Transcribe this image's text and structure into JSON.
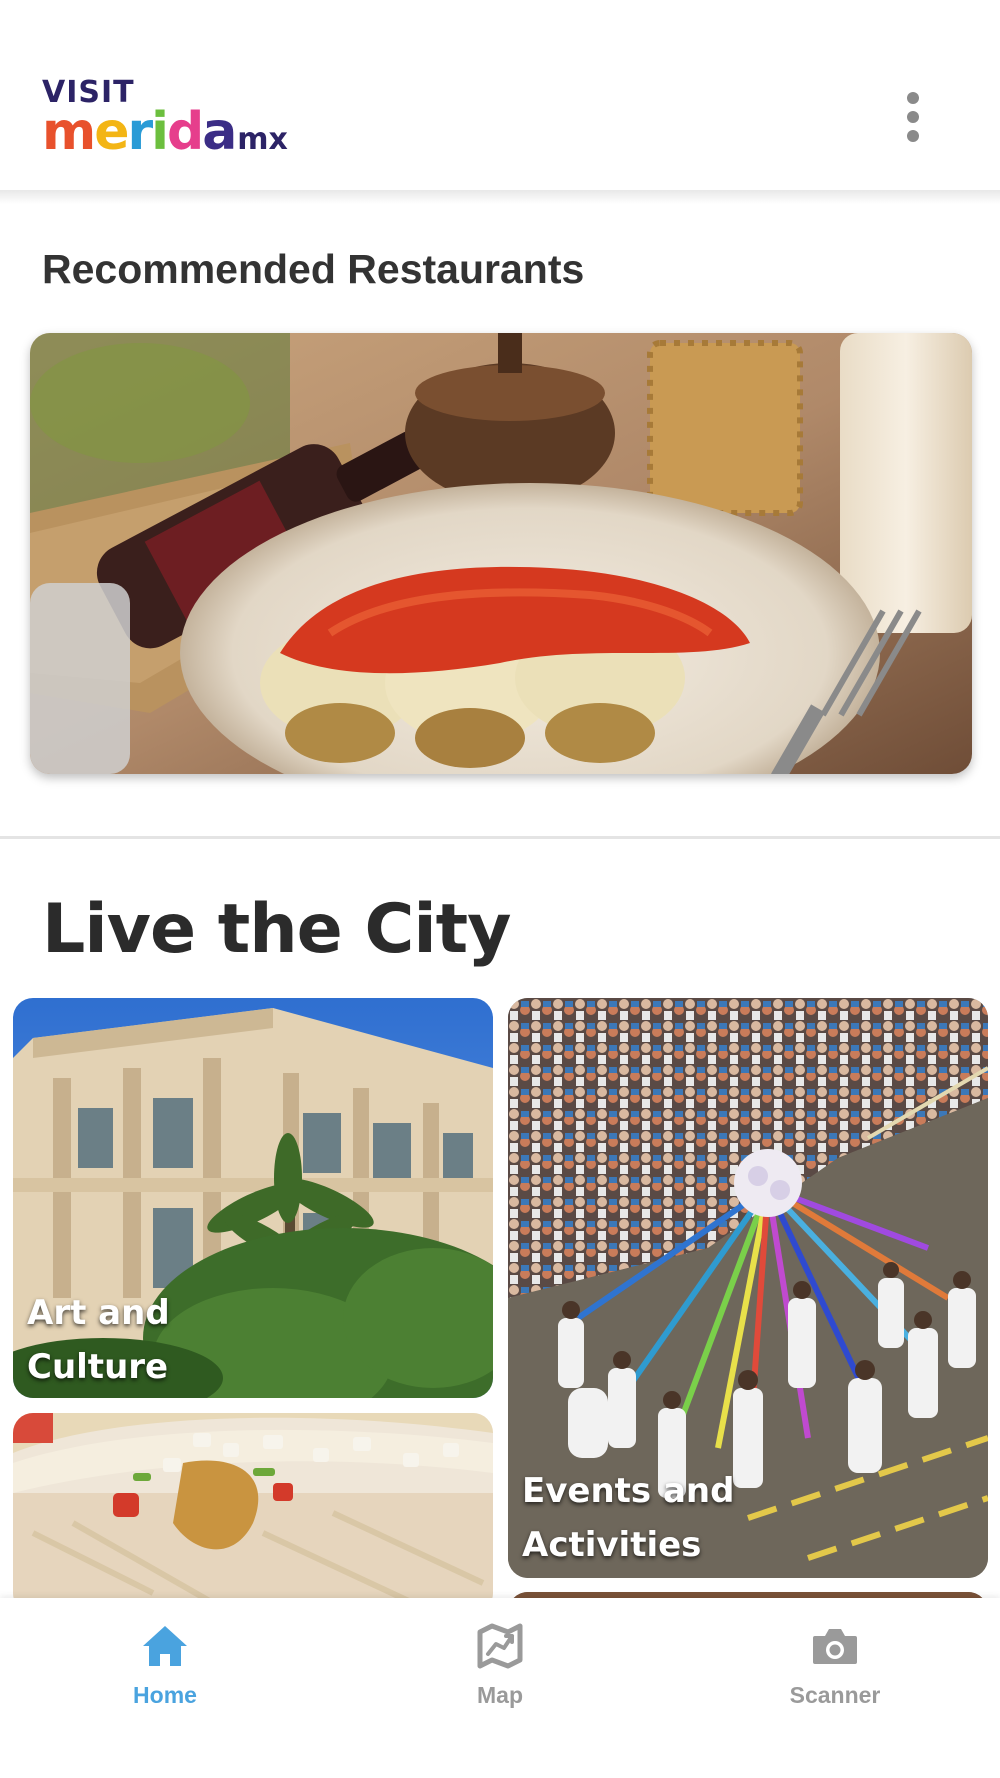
{
  "header": {
    "logo_visit": "VISIT",
    "logo_letters": [
      {
        "char": "m",
        "color": "#e8512c"
      },
      {
        "char": "e",
        "color": "#f3b515"
      },
      {
        "char": "r",
        "color": "#2a9bd6"
      },
      {
        "char": "i",
        "color": "#6cbf3e"
      },
      {
        "char": "d",
        "color": "#e63e8c"
      },
      {
        "char": "a",
        "color": "#3b2d86"
      }
    ],
    "logo_suffix": "mx",
    "more_icon": "more-vertical-icon"
  },
  "recommended": {
    "title": "Recommended Restaurants"
  },
  "live": {
    "title": "Live the City",
    "tiles": [
      {
        "label": "Art and\nCulture"
      },
      {
        "label": "Events and\nActivities"
      }
    ]
  },
  "nav": {
    "items": [
      {
        "label": "Home",
        "icon": "home-icon",
        "active": true
      },
      {
        "label": "Map",
        "icon": "map-icon",
        "active": false
      },
      {
        "label": "Scanner",
        "icon": "camera-icon",
        "active": false
      }
    ],
    "active_color": "#4aa3df",
    "inactive_color": "#9a9a9a"
  }
}
